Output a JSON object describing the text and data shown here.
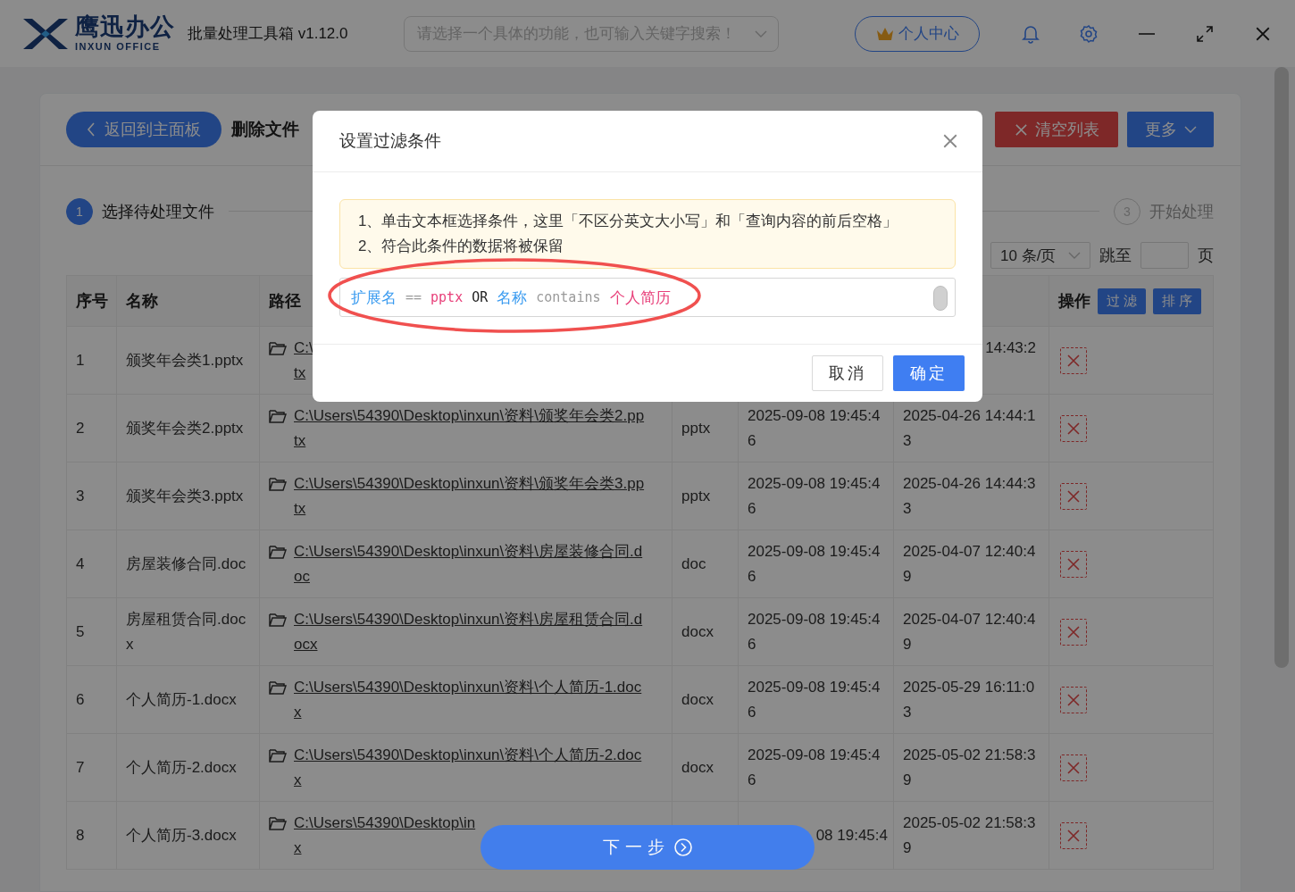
{
  "app": {
    "logo_name": "鹰迅办公",
    "logo_sub": "INXUN OFFICE",
    "title": "批量处理工具箱 v1.12.0",
    "search": {
      "placeholder": "请选择一个具体的功能，也可输入关键字搜索！"
    },
    "user_button": "个人中心"
  },
  "toolbar": {
    "back_button": "返回到主面板",
    "page_title": "删除文件",
    "clear_button": "清空列表",
    "more_button": "更多"
  },
  "steps": [
    {
      "number": "1",
      "label": "选择待处理文件",
      "active": true
    },
    {
      "number": "3",
      "label": "开始处理",
      "active": false
    }
  ],
  "pagination": {
    "page_size": "10 条/页",
    "jump_label": "跳至",
    "page_suffix": "页"
  },
  "table": {
    "columns": [
      {
        "label": "序号"
      },
      {
        "label": "名称"
      },
      {
        "label": "路径"
      },
      {},
      {},
      {},
      {
        "label": "操作"
      }
    ],
    "header_buttons": [
      "过 滤",
      "排 序"
    ],
    "rows": [
      {
        "index": "1",
        "name": [
          "颁奖年会类1.pptx"
        ],
        "path": [
          "C:\\",
          "tx"
        ],
        "modified": [
          "14:43:2"
        ]
      },
      {
        "index": "2",
        "name": [
          "颁奖年会类2.pptx"
        ],
        "path": [
          "C:\\Users\\54390\\Desktop\\inxun\\资料\\颁奖年会类2.pp",
          "tx"
        ],
        "ext": [
          "pptx"
        ],
        "created": [
          "2025-09-08 19:45:4",
          "6"
        ],
        "modified": [
          "2025-04-26 14:44:1",
          "3"
        ]
      },
      {
        "index": "3",
        "name": [
          "颁奖年会类3.pptx"
        ],
        "path": [
          "C:\\Users\\54390\\Desktop\\inxun\\资料\\颁奖年会类3.pp",
          "tx"
        ],
        "ext": [
          "pptx"
        ],
        "created": [
          "2025-09-08 19:45:4",
          "6"
        ],
        "modified": [
          "2025-04-26 14:44:3",
          "3"
        ]
      },
      {
        "index": "4",
        "name": [
          "房屋装修合同.doc"
        ],
        "path": [
          "C:\\Users\\54390\\Desktop\\inxun\\资料\\房屋装修合同.d",
          "oc"
        ],
        "ext": [
          "doc"
        ],
        "created": [
          "2025-09-08 19:45:4",
          "6"
        ],
        "modified": [
          "2025-04-07 12:40:4",
          "9"
        ]
      },
      {
        "index": "5",
        "name": [
          "房屋租赁合同.doc",
          "x"
        ],
        "path": [
          "C:\\Users\\54390\\Desktop\\inxun\\资料\\房屋租赁合同.d",
          "ocx"
        ],
        "ext": [
          "docx"
        ],
        "created": [
          "2025-09-08 19:45:4",
          "6"
        ],
        "modified": [
          "2025-04-07 12:40:4",
          "9"
        ]
      },
      {
        "index": "6",
        "name": [
          "个人简历-1.docx"
        ],
        "path": [
          "C:\\Users\\54390\\Desktop\\inxun\\资料\\个人简历-1.doc",
          "x"
        ],
        "ext": [
          "docx"
        ],
        "created": [
          "2025-09-08 19:45:4",
          "6"
        ],
        "modified": [
          "2025-05-29 16:11:0",
          "3"
        ]
      },
      {
        "index": "7",
        "name": [
          "个人简历-2.docx"
        ],
        "path": [
          "C:\\Users\\54390\\Desktop\\inxun\\资料\\个人简历-2.doc",
          "x"
        ],
        "ext": [
          "docx"
        ],
        "created": [
          "2025-09-08 19:45:4",
          "6"
        ],
        "modified": [
          "2025-05-02 21:58:3",
          "9"
        ]
      },
      {
        "index": "8",
        "name": [
          "个人简历-3.docx"
        ],
        "path": [
          "C:\\Users\\54390\\Desktop\\in",
          "x"
        ],
        "created": [
          "08 19:45:4"
        ],
        "modified": [
          "2025-05-02 21:58:3",
          "9"
        ]
      }
    ]
  },
  "next_button": "下一步",
  "dialog": {
    "title": "设置过滤条件",
    "notes": [
      "1、单击文本框选择条件，这里「不区分英文大小写」和「查询内容的前后空格」",
      "2、符合此条件的数据将被保留"
    ],
    "filter_tokens": [
      {
        "text": "扩展名",
        "kind": "field"
      },
      {
        "text": "==",
        "kind": "operator"
      },
      {
        "text": "pptx",
        "kind": "value"
      },
      {
        "text": "OR",
        "kind": "logic"
      },
      {
        "text": "名称",
        "kind": "field"
      },
      {
        "text": "contains",
        "kind": "operator"
      },
      {
        "text": "个人简历",
        "kind": "value"
      }
    ],
    "cancel_button": "取消",
    "ok_button": "确定"
  }
}
